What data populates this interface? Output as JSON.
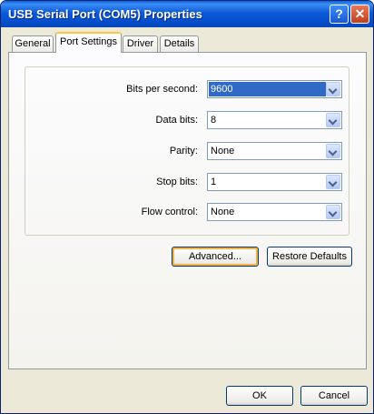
{
  "window": {
    "title": "USB Serial Port (COM5) Properties",
    "help_glyph": "?",
    "close_glyph": "✕"
  },
  "tabs": [
    {
      "label": "General"
    },
    {
      "label": "Port Settings"
    },
    {
      "label": "Driver"
    },
    {
      "label": "Details"
    }
  ],
  "active_tab": "Port Settings",
  "settings": [
    {
      "label": "Bits per second:",
      "value": "9600"
    },
    {
      "label": "Data bits:",
      "value": "8"
    },
    {
      "label": "Parity:",
      "value": "None"
    },
    {
      "label": "Stop bits:",
      "value": "1"
    },
    {
      "label": "Flow control:",
      "value": "None"
    }
  ],
  "buttons": {
    "advanced": "Advanced...",
    "restore": "Restore Defaults",
    "ok": "OK",
    "cancel": "Cancel"
  },
  "colors": {
    "title_bar": "#0b5ad8",
    "selection": "#316ac5",
    "active_tab_accent": "#ffc83c"
  }
}
